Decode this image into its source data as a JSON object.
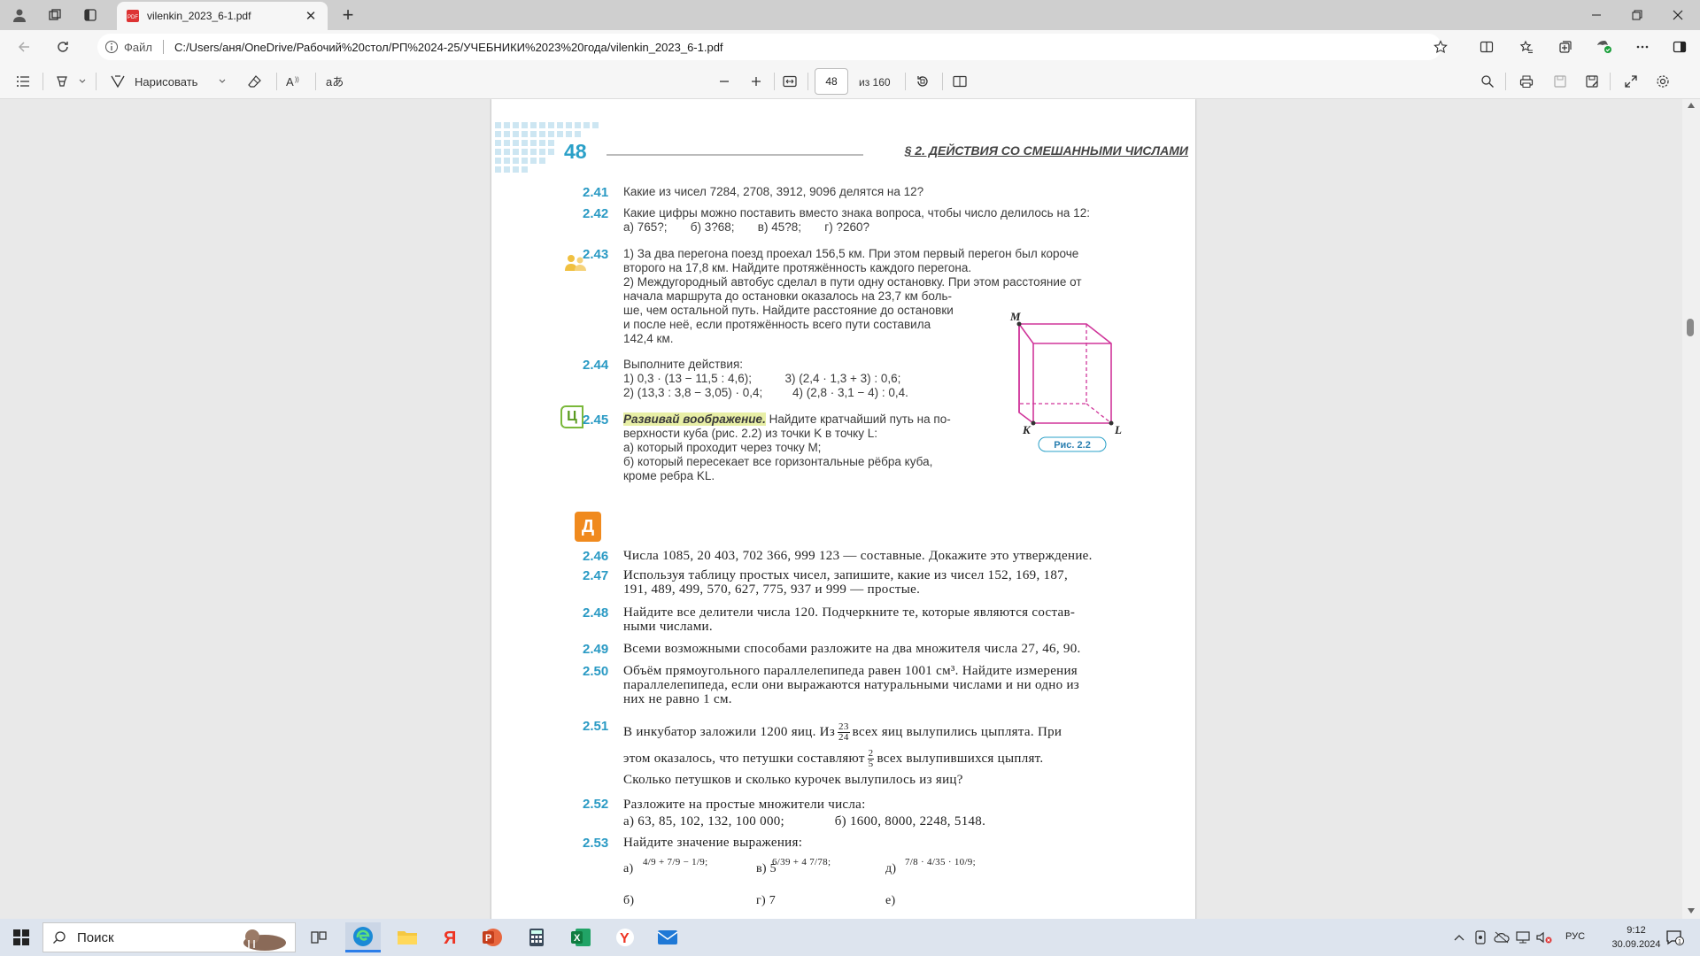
{
  "browser": {
    "tab_title": "vilenkin_2023_6-1.pdf",
    "address": {
      "file_label": "Файл",
      "url": "C:/Users/аня/OneDrive/Рабочий%20стол/РП%2024-25/УЧЕБНИКИ%2023%20года/vilenkin_2023_6-1.pdf"
    }
  },
  "pdf_toolbar": {
    "draw_label": "Нарисовать",
    "page_current": "48",
    "page_total": "из 160"
  },
  "page": {
    "number": "48",
    "section_title": "§ 2. ДЕЙСТВИЯ СО СМЕШАННЫМИ ЧИСЛАМИ",
    "problems": [
      {
        "n": "2.41",
        "lines": [
          "Какие из чисел 7284, 2708, 3912, 9096 делятся на 12?"
        ]
      },
      {
        "n": "2.42",
        "lines": [
          "Какие цифры можно поставить вместо знака вопроса, чтобы число делилось на 12:",
          "а) 765?;       б) 3?68;       в) 45?8;       г) ?260?"
        ]
      },
      {
        "n": "2.43",
        "lines": [
          "1) За два перегона поезд проехал 156,5 км. При этом первый перегон был короче",
          "второго на 17,8 км. Найдите протяжённость каждого перегона.",
          "2) Междугородный автобус сделал в пути одну остановку. При этом расстояние от",
          "начала маршрута до остановки оказалось на 23,7 км боль-",
          "ше, чем остальной путь. Найдите расстояние до остановки",
          "и после неё, если протяжённость всего пути составила",
          "142,4 км."
        ]
      },
      {
        "n": "2.44",
        "lines": [
          "Выполните действия:",
          "1) 0,3 · (13 − 11,5 : 4,6);          3) (2,4 · 1,3 + 3) : 0,6;",
          "2) (13,3 : 3,8 − 3,05) · 0,4;         4) (2,8 · 3,1 − 4) : 0,4."
        ]
      },
      {
        "n": "2.45",
        "highlight": "Развивай воображение.",
        "lines": [
          " Найдите кратчайший путь на по-",
          "верхности куба (рис. 2.2) из точки K в точку L:",
          "а) который проходит через точку M;",
          "б) который пересекает все горизонтальные рёбра куба,",
          "кроме ребра KL."
        ]
      },
      {
        "n": "2.46",
        "lines": [
          "Числа 1085, 20 403, 702 366, 999 123 — составные. Докажите это утверждение."
        ]
      },
      {
        "n": "2.47",
        "lines": [
          "Используя таблицу простых чисел, запишите, какие из чисел 152, 169, 187,",
          "191, 489, 499, 570, 627, 775, 937 и 999 — простые."
        ]
      },
      {
        "n": "2.48",
        "lines": [
          "Найдите все делители числа 120. Подчеркните те, которые являются состав-",
          "ными числами."
        ]
      },
      {
        "n": "2.49",
        "lines": [
          "Всеми возможными способами разложите на два множителя числа 27, 46, 90."
        ]
      },
      {
        "n": "2.50",
        "lines": [
          "Объём прямоугольного параллелепипеда равен 1001 см³. Найдите измерения",
          "параллелепипеда, если они выражаются натуральными числами и ни одно из",
          "них не равно 1 см."
        ]
      },
      {
        "n": "2.51",
        "parts": [
          "В инкубатор заложили 1200 яиц. Из",
          "всех яиц вылупились цыплята. При",
          "этом оказалось, что петушки составляют",
          "всех вылупившихся цыплят.",
          "Сколько петушков и сколько курочек вылупилось из яиц?"
        ],
        "fracs": [
          [
            "23",
            "24"
          ],
          [
            "2",
            "5"
          ]
        ]
      },
      {
        "n": "2.52",
        "lines": [
          "Разложите на простые множители числа:",
          "а) 63, 85, 102, 132, 100 000;              б) 1600, 8000, 2248, 5148."
        ]
      },
      {
        "n": "2.53",
        "lines": [
          "Найдите значение выражения:"
        ],
        "exprs": [
          "а)",
          "в) 5",
          "д)",
          "б)",
          "г) 7",
          "е)"
        ]
      }
    ],
    "figure": {
      "vertex_m": "M",
      "vertex_k": "K",
      "vertex_l": "L",
      "caption": "Рис. 2.2"
    },
    "badge_c": "Ц",
    "badge_d": "Д"
  },
  "taskbar": {
    "search_label": "Поиск",
    "lang": "РУС",
    "time": "9:12",
    "date": "30.09.2024"
  }
}
